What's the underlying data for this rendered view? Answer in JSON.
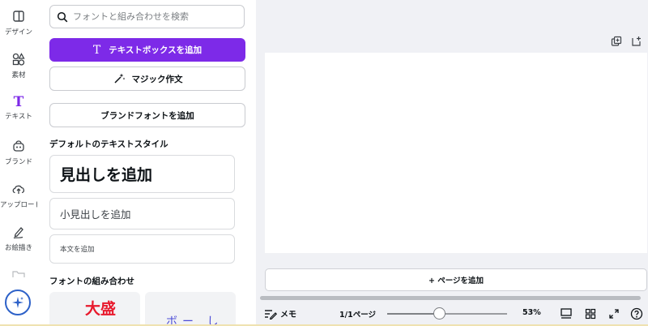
{
  "rail": {
    "items": [
      {
        "label": "デザイン",
        "icon": "layout-icon"
      },
      {
        "label": "素材",
        "icon": "elements-icon"
      },
      {
        "label": "テキスト",
        "icon": "text-icon"
      },
      {
        "label": "ブランド",
        "icon": "brand-icon"
      },
      {
        "label": "アップロード",
        "icon": "upload-icon"
      },
      {
        "label": "お絵描き",
        "icon": "draw-icon"
      }
    ],
    "active_color": "#7d2ae8"
  },
  "panel": {
    "search_placeholder": "フォントと組み合わせを検索",
    "add_textbox_label": "テキストボックスを追加",
    "magic_write_label": "マジック作文",
    "add_brand_font_label": "ブランドフォントを追加",
    "default_styles_title": "デフォルトのテキストスタイル",
    "heading_label": "見出しを追加",
    "subheading_label": "小見出しを追加",
    "body_label": "本文を追加",
    "combos_title": "フォントの組み合わせ",
    "combo1_text": "大盛",
    "combo2_text": "ボー し"
  },
  "workspace": {
    "add_page_label": "+ ページを追加"
  },
  "footer": {
    "memo_label": "メモ",
    "page_count": "1/1ページ",
    "zoom_value": 53,
    "zoom_label": "53%"
  },
  "colors": {
    "primary": "#7d2ae8",
    "workspace_bg": "#f0f1f5",
    "magic_ring": "#2d61c8"
  }
}
